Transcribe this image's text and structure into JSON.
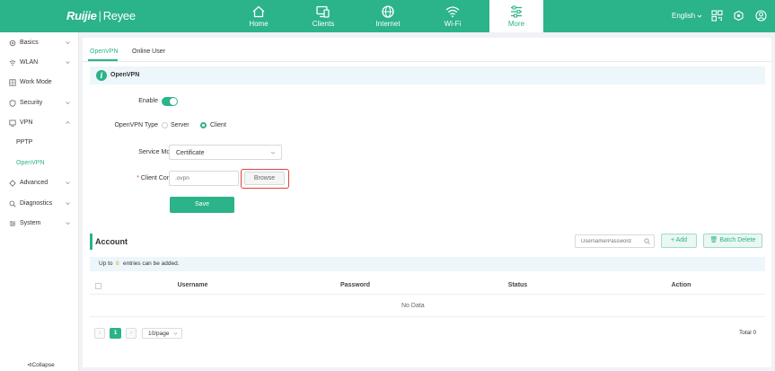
{
  "brand": {
    "logo_main": "Ruijie",
    "logo_sub": "Reyee"
  },
  "nav": {
    "items": [
      {
        "label": "Home",
        "icon": "home-icon"
      },
      {
        "label": "Clients",
        "icon": "clients-icon"
      },
      {
        "label": "Internet",
        "icon": "globe-icon"
      },
      {
        "label": "Wi-Fi",
        "icon": "wifi-icon"
      },
      {
        "label": "More",
        "icon": "sliders-icon",
        "active": true
      }
    ],
    "language": "English"
  },
  "sidebar": {
    "items": [
      {
        "label": "Basics",
        "icon": "gear-icon"
      },
      {
        "label": "WLAN",
        "icon": "wifi-icon"
      },
      {
        "label": "Work Mode",
        "icon": "grid-icon"
      },
      {
        "label": "Security",
        "icon": "shield-icon"
      },
      {
        "label": "VPN",
        "icon": "vpn-icon"
      },
      {
        "label": "Advanced",
        "icon": "advanced-icon"
      },
      {
        "label": "Diagnostics",
        "icon": "diagnostics-icon"
      },
      {
        "label": "System",
        "icon": "system-icon"
      }
    ],
    "sub_items": [
      {
        "label": "PPTP"
      },
      {
        "label": "OpenVPN",
        "active": true
      }
    ],
    "collapse_label": "Collapse"
  },
  "tabs": [
    {
      "label": "OpenVPN",
      "active": true
    },
    {
      "label": "Online User"
    }
  ],
  "section": {
    "info_glyph": "i",
    "title": "OpenVPN"
  },
  "form": {
    "enable_label": "Enable",
    "enable_on": true,
    "type_label": "OpenVPN Type",
    "type_options": [
      "Server",
      "Client"
    ],
    "type_selected": "Client",
    "service_mode_label": "Service Mode",
    "service_mode_value": "Certificate",
    "client_config_required": "*",
    "client_config_label": "Client Config",
    "client_config_placeholder": ".ovpn",
    "browse_label": "Browse",
    "save_label": "Save"
  },
  "account": {
    "title": "Account",
    "search_placeholder": "Username/Password",
    "add_label": "+ Add",
    "batch_delete_label": "Batch Delete",
    "notice_prefix": "Up to",
    "notice_count": "8",
    "notice_suffix": "entries can be added.",
    "columns": [
      "Username",
      "Password",
      "Status",
      "Action"
    ],
    "empty_text": "No Data"
  },
  "pagination": {
    "current_page": "1",
    "page_size": "10/page",
    "total": "Total 0",
    "prev_glyph": "‹",
    "next_glyph": "›"
  },
  "colors": {
    "accent": "#2bb38a",
    "highlight_border": "#e0413f"
  }
}
